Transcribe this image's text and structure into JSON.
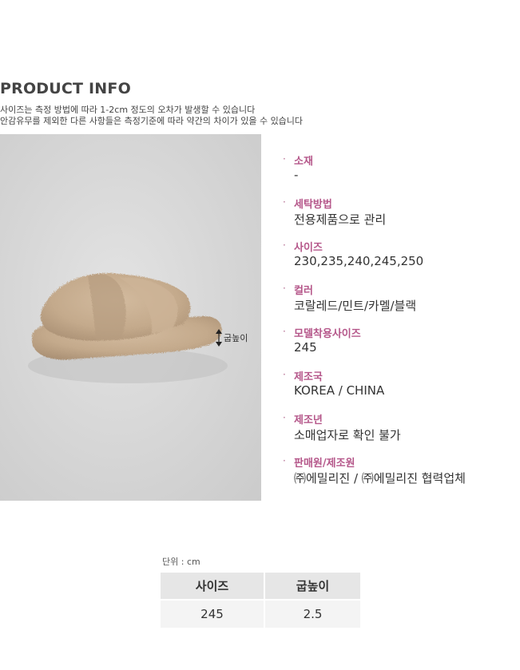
{
  "header": {
    "title": "PRODUCT INFO",
    "notes": [
      "사이즈는 측정 방법에 따라 1-2cm 정도의 오차가 발생할 수 있습니다",
      "안감유무를 제외한 다른 사항들은 측정기준에 따라 약간의 차이가 있을 수 있습니다"
    ]
  },
  "photo": {
    "height_label": "굽높이",
    "background_color": "#d8d8d8",
    "slipper_color": "#c4aa8c"
  },
  "specs": [
    {
      "bullet": "·",
      "label": "소재",
      "value": "-"
    },
    {
      "bullet": "·",
      "label": "세탁방법",
      "value": "전용제품으로 관리"
    },
    {
      "bullet": "·",
      "label": "사이즈",
      "value": "230,235,240,245,250"
    },
    {
      "bullet": "·",
      "label": "컬러",
      "value": "코랄레드/민트/카멜/블랙"
    },
    {
      "bullet": "·",
      "label": "모델착용사이즈",
      "value": "245"
    },
    {
      "bullet": "·",
      "label": "제조국",
      "value": "KOREA / CHINA"
    },
    {
      "bullet": "·",
      "label": "제조년",
      "value": "소매업자로 확인 불가"
    },
    {
      "bullet": "·",
      "label": "판매원/제조원",
      "value": "㈜에밀리진 / ㈜에밀리진 협력업체"
    }
  ],
  "size_table": {
    "unit": "단위 : cm",
    "headers": [
      "사이즈",
      "굽높이"
    ],
    "rows": [
      [
        "245",
        "2.5"
      ]
    ]
  },
  "colors": {
    "accent_label": "#b5578a",
    "text": "#333333"
  }
}
